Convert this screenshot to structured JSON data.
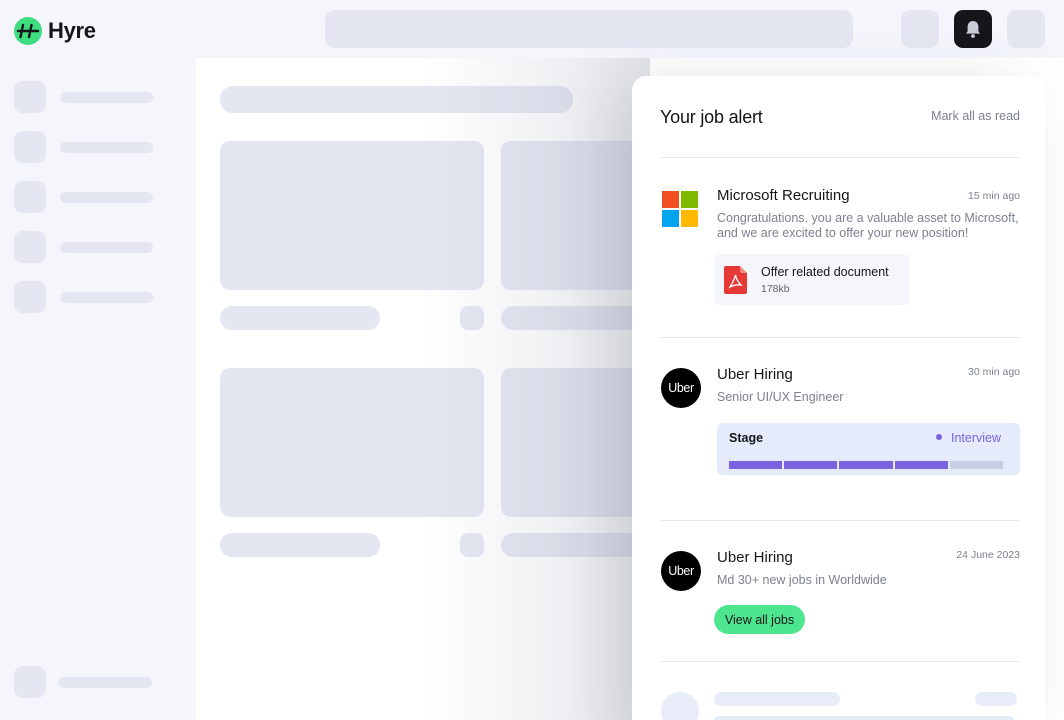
{
  "app": {
    "logo_text": "Hyre",
    "brand_color": "#3ddc7e"
  },
  "header": {
    "icons": [
      "logo-icon",
      "bell-icon"
    ]
  },
  "panel": {
    "title": "Your job alert",
    "mark_all_label": "Mark all as read",
    "notifications": [
      {
        "company": "Microsoft Recruiting",
        "time": "15 min ago",
        "message": "Congratulations. you are a valuable asset to Microsoft, and we are excited to offer your new position!",
        "attachment": {
          "name": "Offer related document",
          "size": "178kb",
          "icon": "pdf-icon"
        }
      },
      {
        "company": "Uber Hiring",
        "logo_text": "Uber",
        "time": "30 min ago",
        "message": "Senior UI/UX Engineer",
        "stage": {
          "label": "Stage",
          "value": "Interview",
          "completed_steps": 4,
          "total_steps": 5,
          "color": "#7b63e0"
        }
      },
      {
        "company": "Uber Hiring",
        "logo_text": "Uber",
        "time": "24 June 2023",
        "message": "Md 30+ new jobs in Worldwide",
        "action_label": "View all jobs",
        "action_color": "#4ee58f"
      }
    ]
  }
}
